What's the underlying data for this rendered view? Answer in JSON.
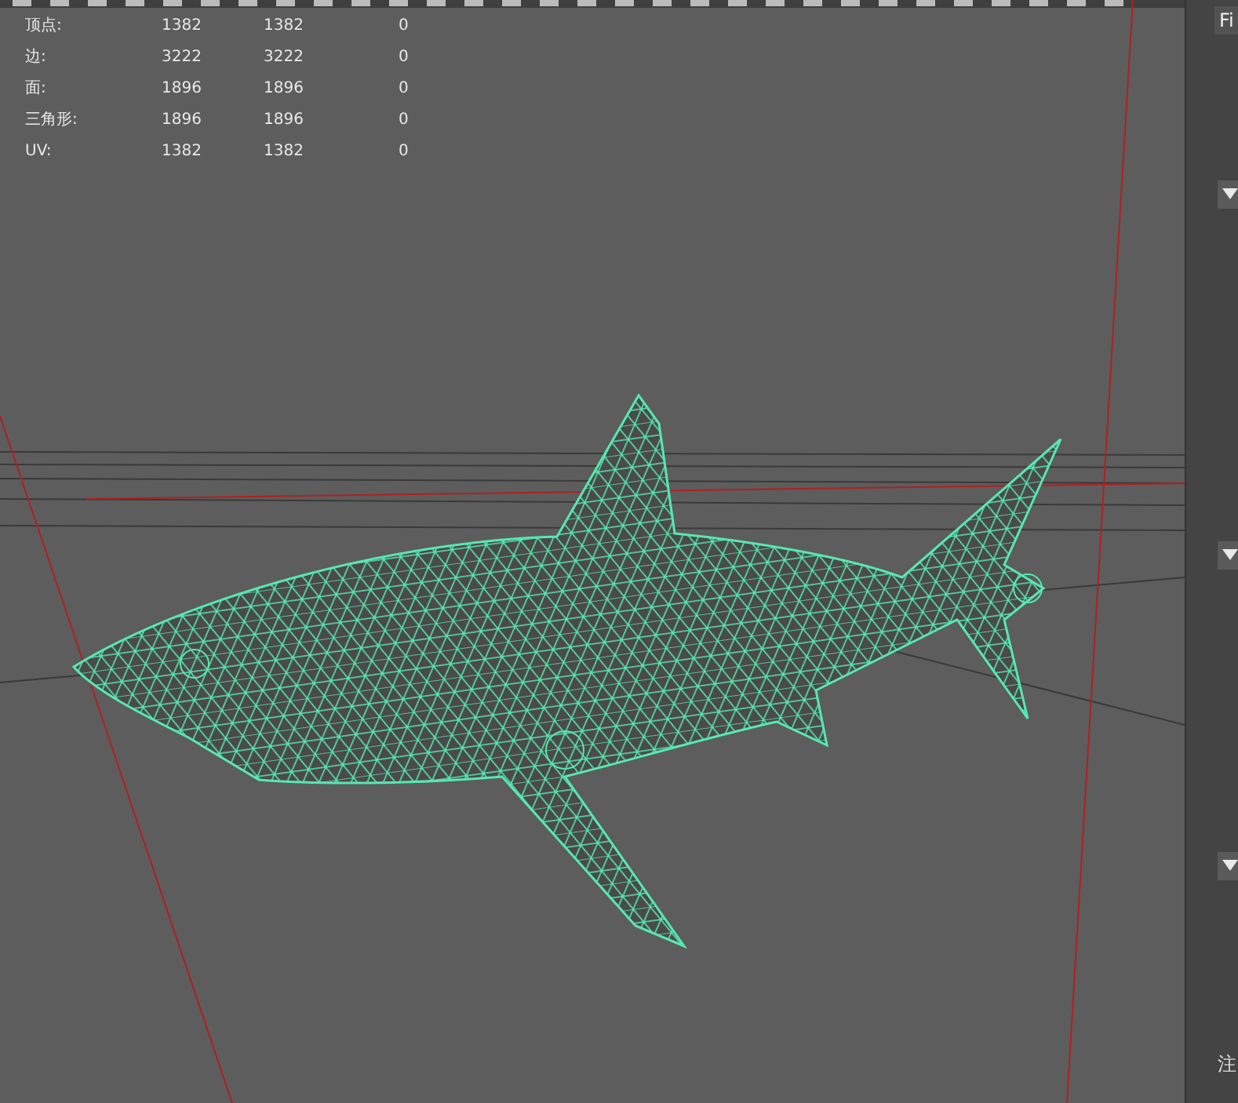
{
  "stats": [
    {
      "label": "顶点:",
      "values": [
        "1382",
        "1382",
        "0"
      ]
    },
    {
      "label": "边:",
      "values": [
        "3222",
        "3222",
        "0"
      ]
    },
    {
      "label": "面:",
      "values": [
        "1896",
        "1896",
        "0"
      ]
    },
    {
      "label": "三角形:",
      "values": [
        "1896",
        "1896",
        "0"
      ]
    },
    {
      "label": "UV:",
      "values": [
        "1382",
        "1382",
        "0"
      ]
    }
  ],
  "side_panel": {
    "tab": "Fi",
    "sections": [
      {
        "expanded": true
      },
      {
        "expanded": true
      },
      {
        "expanded": true
      }
    ],
    "footer": "注"
  }
}
